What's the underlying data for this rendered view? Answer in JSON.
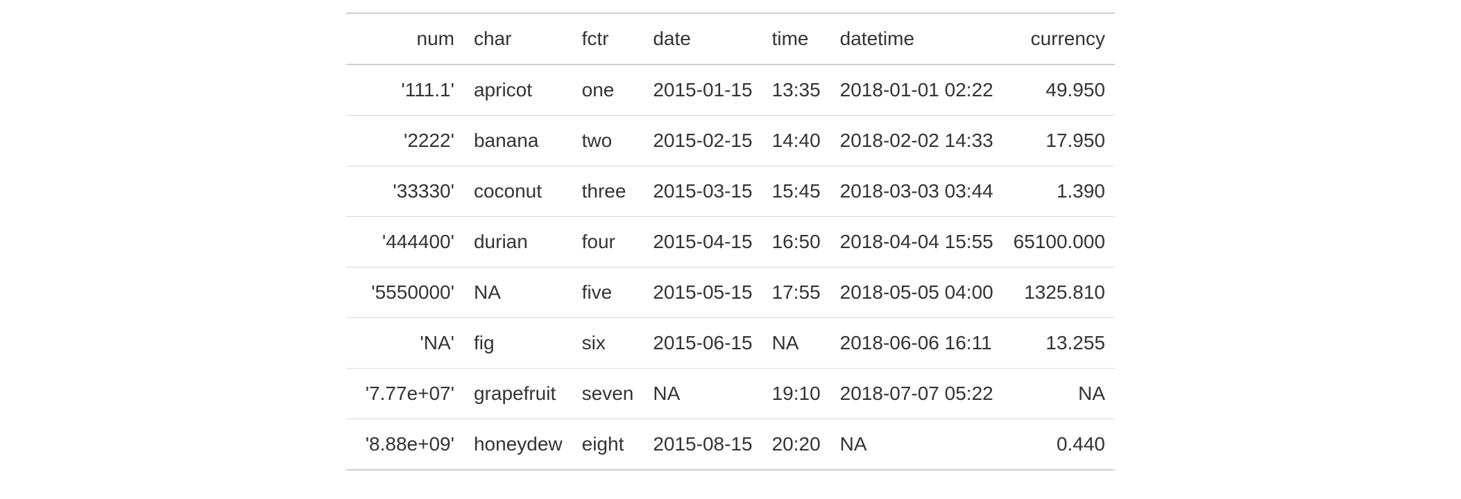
{
  "table": {
    "headers": {
      "num": "num",
      "char": "char",
      "fctr": "fctr",
      "date": "date",
      "time": "time",
      "datetime": "datetime",
      "currency": "currency"
    },
    "rows": [
      {
        "num": "'111.1'",
        "char": "apricot",
        "fctr": "one",
        "date": "2015-01-15",
        "time": "13:35",
        "datetime": "2018-01-01 02:22",
        "currency": "49.950"
      },
      {
        "num": "'2222'",
        "char": "banana",
        "fctr": "two",
        "date": "2015-02-15",
        "time": "14:40",
        "datetime": "2018-02-02 14:33",
        "currency": "17.950"
      },
      {
        "num": "'33330'",
        "char": "coconut",
        "fctr": "three",
        "date": "2015-03-15",
        "time": "15:45",
        "datetime": "2018-03-03 03:44",
        "currency": "1.390"
      },
      {
        "num": "'444400'",
        "char": "durian",
        "fctr": "four",
        "date": "2015-04-15",
        "time": "16:50",
        "datetime": "2018-04-04 15:55",
        "currency": "65100.000"
      },
      {
        "num": "'5550000'",
        "char": "NA",
        "fctr": "five",
        "date": "2015-05-15",
        "time": "17:55",
        "datetime": "2018-05-05 04:00",
        "currency": "1325.810"
      },
      {
        "num": "'NA'",
        "char": "fig",
        "fctr": "six",
        "date": "2015-06-15",
        "time": "NA",
        "datetime": "2018-06-06 16:11",
        "currency": "13.255"
      },
      {
        "num": "'7.77e+07'",
        "char": "grapefruit",
        "fctr": "seven",
        "date": "NA",
        "time": "19:10",
        "datetime": "2018-07-07 05:22",
        "currency": "NA"
      },
      {
        "num": "'8.88e+09'",
        "char": "honeydew",
        "fctr": "eight",
        "date": "2015-08-15",
        "time": "20:20",
        "datetime": "NA",
        "currency": "0.440"
      }
    ]
  }
}
